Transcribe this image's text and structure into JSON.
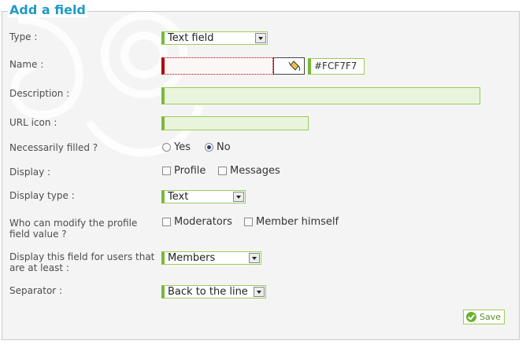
{
  "panel": {
    "title": "Add a field"
  },
  "fields": {
    "type": {
      "label": "Type :",
      "value": "Text field"
    },
    "name": {
      "label": "Name :",
      "value": "",
      "color_value": "#FCF7F7",
      "color_icon": "paint-bucket-icon"
    },
    "description": {
      "label": "Description :",
      "value": ""
    },
    "url_icon": {
      "label": "URL icon :",
      "value": ""
    },
    "necessarily_filled": {
      "label": "Necessarily filled ?",
      "options": [
        "Yes",
        "No"
      ],
      "selected": "No"
    },
    "display": {
      "label": "Display :",
      "options": [
        "Profile",
        "Messages"
      ]
    },
    "display_type": {
      "label": "Display type :",
      "value": "Text"
    },
    "who_can_modify": {
      "label": "Who can modify the profile field value ?",
      "options": [
        "Moderators",
        "Member himself"
      ]
    },
    "display_for_users": {
      "label": "Display this field for users that are at least :",
      "value": "Members"
    },
    "separator": {
      "label": "Separator :",
      "value": "Back to the line"
    }
  },
  "save_button": {
    "label": "Save",
    "icon": "checkmark-icon"
  },
  "colors": {
    "accent": "#1e9bc4",
    "field_border": "#7ab83a",
    "error_border": "#b00000",
    "panel_bg": "#f4f4f4"
  }
}
